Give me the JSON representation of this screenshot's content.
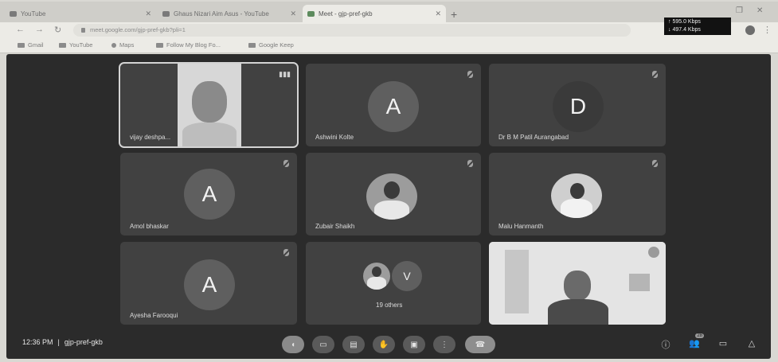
{
  "browser": {
    "tabs": [
      {
        "title": "YouTube"
      },
      {
        "title": "Ghaus Nizari Aim Asus - YouTube"
      },
      {
        "title": "Meet - gjp-pref-gkb"
      }
    ],
    "network": {
      "up": "↑ 595.0 Kbps",
      "down": "↓ 497.4 Kbps"
    },
    "url": "meet.google.com/gjp-pref-gkb?pli=1",
    "bookmarks": [
      "Gmail",
      "YouTube",
      "Maps",
      "Follow My Blog Fo...",
      "Google Keep"
    ]
  },
  "meet": {
    "tiles": [
      {
        "name": "vijay deshpa...",
        "kind": "video"
      },
      {
        "name": "Ashwini Kolte",
        "kind": "avatar",
        "letter": "A"
      },
      {
        "name": "Dr B M Patil Aurangabad",
        "kind": "avatar",
        "letter": "D"
      },
      {
        "name": "Amol bhaskar",
        "kind": "avatar",
        "letter": "A"
      },
      {
        "name": "Zubair Shaikh",
        "kind": "photo"
      },
      {
        "name": "Malu Hanmanth",
        "kind": "photo"
      },
      {
        "name": "Ayesha Farooqui",
        "kind": "avatar",
        "letter": "A"
      },
      {
        "name": "19 others",
        "kind": "others",
        "letter": "V"
      },
      {
        "name": "",
        "kind": "video"
      }
    ],
    "time": "12:36 PM",
    "meeting_code": "gjp-pref-gkb",
    "participants_count": "28"
  }
}
